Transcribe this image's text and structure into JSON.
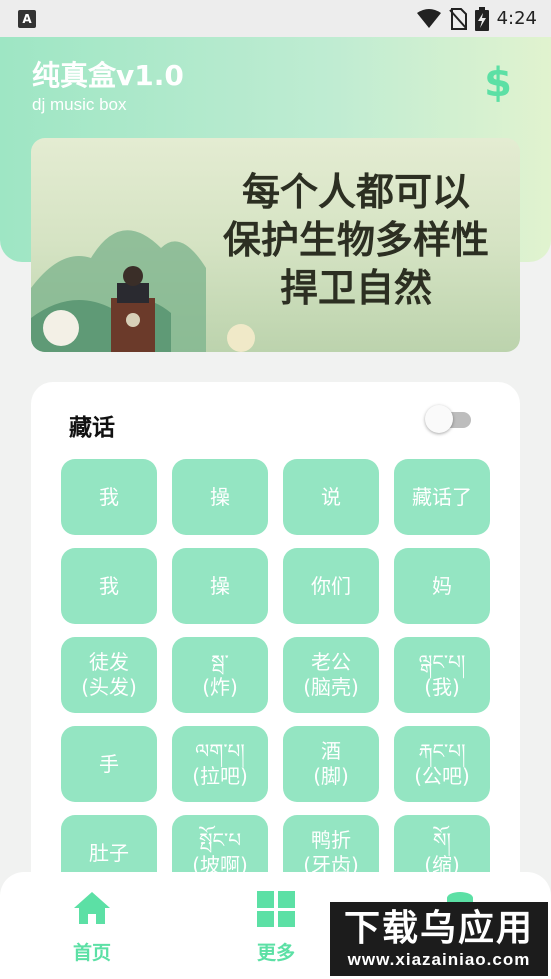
{
  "status_bar": {
    "app_badge": "A",
    "time": "4:24",
    "icons": [
      "wifi-icon",
      "no-sim-icon",
      "battery-charging-icon"
    ]
  },
  "header": {
    "title": "纯真盒v1.0",
    "subtitle": "dj music box",
    "action_icon": "dollar-icon",
    "action_symbol": "$"
  },
  "banner": {
    "lines": [
      "每个人都可以",
      "保护生物多样性",
      "捍卫自然"
    ]
  },
  "card": {
    "title": "藏话",
    "toggle_on": false,
    "buttons": [
      "我",
      "操",
      "说",
      "藏话了",
      "我",
      "操",
      "你们",
      "妈",
      "徒发\n(头发)",
      "སྦ་\n(炸)",
      "老公\n(脑壳)",
      "ལྒང་པ།\n(我)",
      "手",
      "ལག་པ།\n(拉吧)",
      "酒\n(脚)",
      "རྐང་པ།\n(公吧)",
      "肚子",
      "སྤོང་པ\n(坡啊)",
      "鸭折\n(牙齿)",
      "སོ།\n(缩)"
    ]
  },
  "bottom_nav": {
    "items": [
      {
        "label": "首页",
        "icon": "home-icon"
      },
      {
        "label": "更多",
        "icon": "grid-icon"
      },
      {
        "label": "",
        "icon": "database-icon"
      }
    ]
  },
  "watermark": {
    "title": "下载乌应用",
    "url": "www.xiazainiao.com"
  },
  "colors": {
    "accent": "#5ce0a5",
    "button_bg": "#94e5c2",
    "header_gradient_start": "#9ee6c4",
    "header_gradient_end": "#e1f3cf"
  }
}
